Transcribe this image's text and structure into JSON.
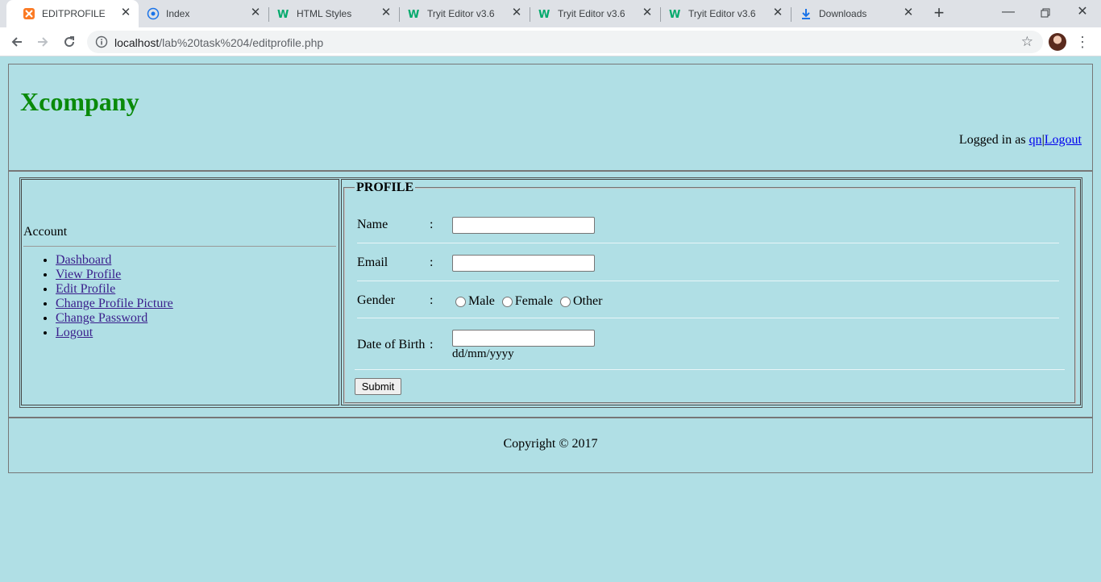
{
  "browser": {
    "tabs": [
      {
        "title": "EDITPROFILE",
        "icon": "xampp-icon",
        "active": true
      },
      {
        "title": "Index",
        "icon": "globe-icon"
      },
      {
        "title": "HTML Styles",
        "icon": "w3schools-icon"
      },
      {
        "title": "Tryit Editor v3.6",
        "icon": "w3schools-icon"
      },
      {
        "title": "Tryit Editor v3.6",
        "icon": "w3schools-icon"
      },
      {
        "title": "Tryit Editor v3.6",
        "icon": "w3schools-icon"
      },
      {
        "title": "Downloads",
        "icon": "download-icon"
      }
    ],
    "url_host": "localhost",
    "url_path": "/lab%20task%204/editprofile.php"
  },
  "header": {
    "logo": "Xcompany",
    "logged_in_prefix": "Logged in as ",
    "username": "qn",
    "separator": "|",
    "logout": "Logout"
  },
  "sidebar": {
    "heading": "Account",
    "items": [
      {
        "label": "Dashboard"
      },
      {
        "label": "View Profile"
      },
      {
        "label": "Edit Profile"
      },
      {
        "label": "Change Profile Picture"
      },
      {
        "label": "Change Password"
      },
      {
        "label": "Logout"
      }
    ]
  },
  "form": {
    "legend": "PROFILE",
    "colon": ":",
    "name_label": "Name",
    "name_value": "",
    "email_label": "Email",
    "email_value": "",
    "gender_label": "Gender",
    "gender_options": [
      "Male",
      "Female",
      "Other"
    ],
    "dob_label": "Date of Birth",
    "dob_value": "",
    "dob_hint": "dd/mm/yyyy",
    "submit": "Submit"
  },
  "footer": {
    "copyright": "Copyright © 2017"
  },
  "colors": {
    "page_bg": "#b0dfe5",
    "logo": "#0a8a0a"
  }
}
